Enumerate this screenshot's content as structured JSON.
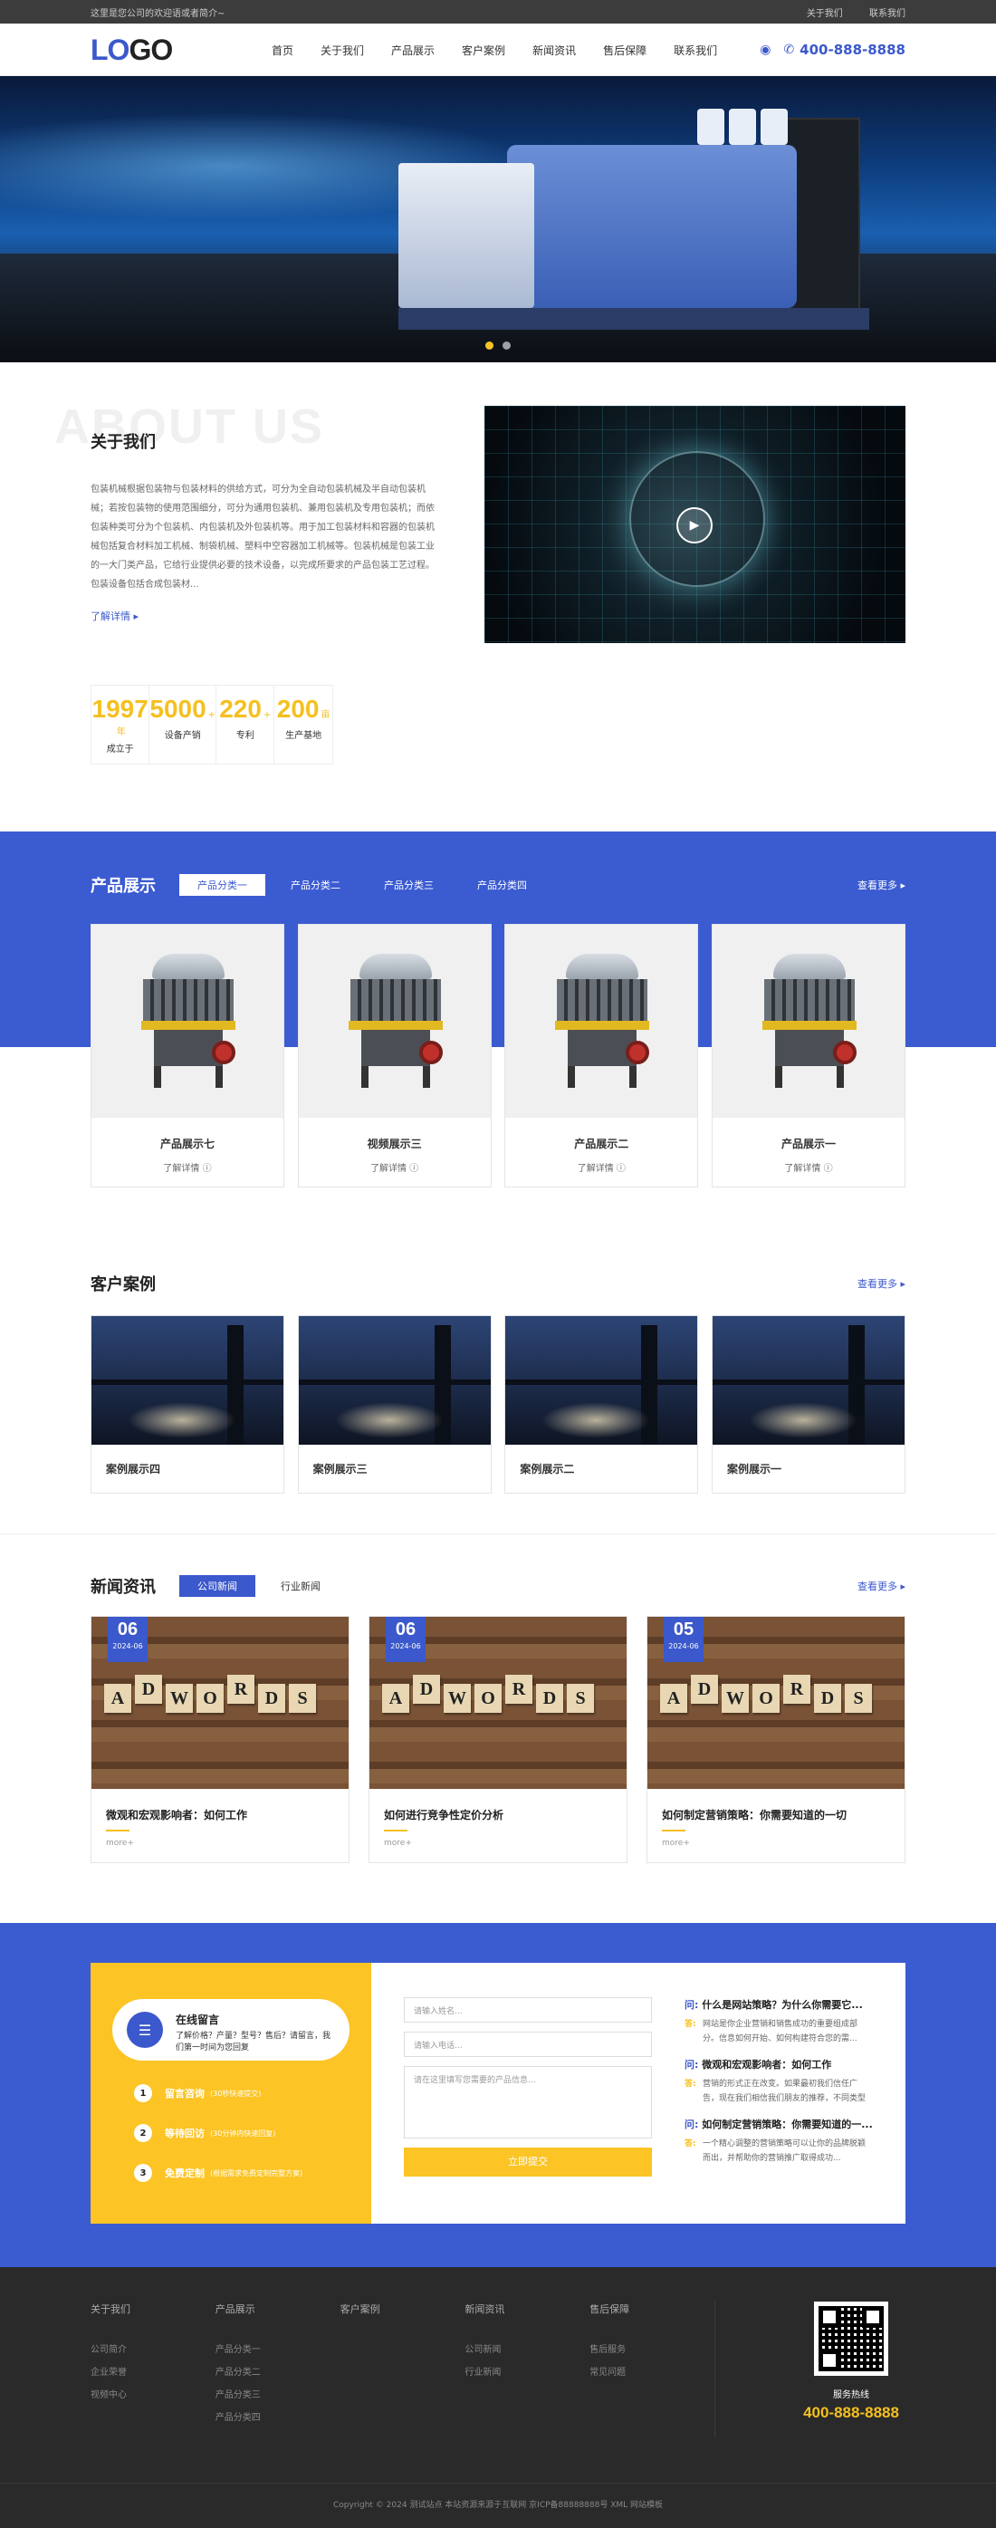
{
  "topbar": {
    "welcome": "这里是您公司的欢迎语或者简介~",
    "links": [
      "关于我们",
      "联系我们"
    ]
  },
  "header": {
    "logo_a": "LO",
    "logo_b": "GO",
    "nav": [
      "首页",
      "关于我们",
      "产品展示",
      "客户案例",
      "新闻资讯",
      "售后保障",
      "联系我们"
    ],
    "phone": "400-888-8888"
  },
  "banner": {
    "dots": 2,
    "active": 0
  },
  "about": {
    "bg_text": "ABOUT US",
    "title": "关于我们",
    "text": "包装机械根据包装物与包装材料的供给方式，可分为全自动包装机械及半自动包装机械；若按包装物的使用范围细分，可分为通用包装机、兼用包装机及专用包装机；而依包装种类可分为个包装机、内包装机及外包装机等。用于加工包装材料和容器的包装机械包括复合材料加工机械、制袋机械、塑料中空容器加工机械等。包装机械是包装工业的一大门类产品，它给行业提供必要的技术设备，以完成所要求的产品包装工艺过程。包装设备包括合成包装材...",
    "more": "了解详情"
  },
  "stats": [
    {
      "num": "1997",
      "unit": "年",
      "label": "成立于"
    },
    {
      "num": "5000",
      "unit": "+",
      "label": "设备产销"
    },
    {
      "num": "220",
      "unit": "+",
      "label": "专利"
    },
    {
      "num": "200",
      "unit": "亩",
      "label": "生产基地"
    }
  ],
  "products": {
    "title": "产品展示",
    "tabs": [
      "产品分类一",
      "产品分类二",
      "产品分类三",
      "产品分类四"
    ],
    "more": "查看更多",
    "items": [
      {
        "name": "产品展示七",
        "more": "了解详情"
      },
      {
        "name": "视频展示三",
        "more": "了解详情"
      },
      {
        "name": "产品展示二",
        "more": "了解详情"
      },
      {
        "name": "产品展示一",
        "more": "了解详情"
      }
    ]
  },
  "cases": {
    "title": "客户案例",
    "more": "查看更多",
    "items": [
      "案例展示四",
      "案例展示三",
      "案例展示二",
      "案例展示一"
    ]
  },
  "news": {
    "title": "新闻资讯",
    "tabs": [
      "公司新闻",
      "行业新闻"
    ],
    "more": "查看更多",
    "tiles": [
      "A",
      "D",
      "W",
      "O",
      "R",
      "D",
      "S"
    ],
    "items": [
      {
        "day": "06",
        "month": "2024-06",
        "title": "微观和宏观影响者：如何工作",
        "more": "more+"
      },
      {
        "day": "06",
        "month": "2024-06",
        "title": "如何进行竞争性定价分析",
        "more": "more+"
      },
      {
        "day": "05",
        "month": "2024-06",
        "title": "如何制定营销策略：你需要知道的一切",
        "more": "more+"
      }
    ]
  },
  "message": {
    "title": "在线留言",
    "subtitle": "了解价格？产量？型号？售后？请留言，我们第一时间为您回复",
    "steps": [
      {
        "n": "1",
        "label": "留言咨询",
        "sub": "(30秒快速提交)"
      },
      {
        "n": "2",
        "label": "等待回访",
        "sub": "(30分钟内快速回复)"
      },
      {
        "n": "3",
        "label": "免费定制",
        "sub": "(根据需求免费定制完整方案)"
      }
    ],
    "name_placeholder": "请输入姓名...",
    "phone_placeholder": "请输入电话...",
    "content_placeholder": "请在这里填写您需要的产品信息...",
    "submit": "立即提交",
    "q_mark": "问:",
    "a_mark": "答:",
    "faqs": [
      {
        "q": "什么是网站策略？为什么你需要它...",
        "a": "网站是你企业营销和销售成功的重要组成部分。信息如何开始、如何构建符合您的需..."
      },
      {
        "q": "微观和宏观影响者：如何工作",
        "a": "营销的形式正在改变。如果最初我们信任广告，现在我们相信我们朋友的推荐，不同类型产品的影..."
      },
      {
        "q": "如何制定营销策略：你需要知道的一...",
        "a": "一个精心调整的营销策略可以让你的品牌脱颖而出，并帮助你的营销推广取得成功..."
      }
    ]
  },
  "footer": {
    "cols": [
      {
        "h": "关于我们",
        "items": [
          "公司简介",
          "企业荣誉",
          "视频中心"
        ]
      },
      {
        "h": "产品展示",
        "items": [
          "产品分类一",
          "产品分类二",
          "产品分类三",
          "产品分类四"
        ]
      },
      {
        "h": "客户案例",
        "items": []
      },
      {
        "h": "新闻资讯",
        "items": [
          "公司新闻",
          "行业新闻"
        ]
      },
      {
        "h": "售后保障",
        "items": [
          "售后服务",
          "常见问题"
        ]
      }
    ],
    "hotline_label": "服务热线",
    "hotline": "400-888-8888",
    "copyright": "Copyright © 2024 测试站点 本站资源来源于互联网 京ICP备88888888号 XML 网站模板"
  },
  "colors": {
    "primary": "#3b58cc",
    "accent": "#f5c020",
    "footer_bg": "#2a2a2a"
  }
}
